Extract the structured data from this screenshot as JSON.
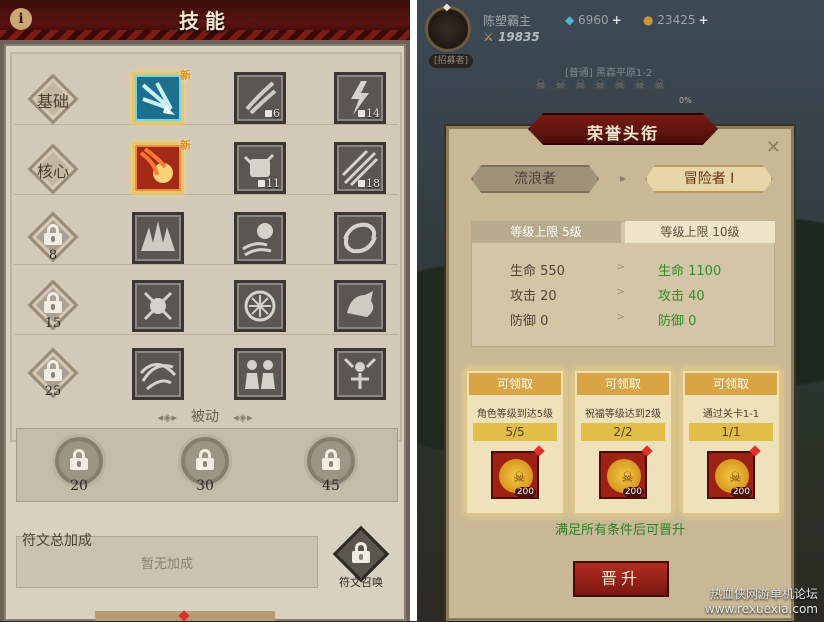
{
  "left": {
    "title": "技能",
    "info_icon": "i",
    "row_labels": [
      "基础",
      "核心"
    ],
    "lock_rows": [
      {
        "level": "8"
      },
      {
        "level": "15"
      },
      {
        "level": "25"
      }
    ],
    "new_tag": "新",
    "skill_levels": [
      "6",
      "14",
      "11",
      "18"
    ],
    "passive_label": "被动",
    "passive_slots": [
      "20",
      "30",
      "45"
    ],
    "rune_title": "符文总加成",
    "rune_empty": "暂无加成",
    "rune_summon": "符文召唤"
  },
  "right": {
    "player_name": "陈塑霸主",
    "power": "19835",
    "gems": "6960",
    "gold": "23425",
    "hire": "[招募者]",
    "stage": "[普通] 黑森平原1-2",
    "boss_pct": "0%",
    "modal": {
      "title": "荣誉头衔",
      "close": "✕",
      "rank_from": "流浪者",
      "rank_to": "冒险者 I",
      "limit_from": "等级上限 5级",
      "limit_to": "等级上限 10级",
      "stats": [
        {
          "old": "生命 550",
          "new": "生命 1100"
        },
        {
          "old": "攻击 20",
          "new": "攻击 40"
        },
        {
          "old": "防御 0",
          "new": "防御 0"
        }
      ],
      "rewards": [
        {
          "status": "可领取",
          "condition": "角色等级到达5级",
          "progress": "5/5",
          "qty": "200"
        },
        {
          "status": "可领取",
          "condition": "祝福等级达到2级",
          "progress": "2/2",
          "qty": "200"
        },
        {
          "status": "可领取",
          "condition": "通过关卡1-1",
          "progress": "1/1",
          "qty": "200"
        }
      ],
      "requirement": "满足所有条件后可晋升",
      "promote_label": "晋升"
    },
    "watermark_line1": "热血侠网游单机论坛",
    "watermark_line2": "www.rexuexia.com"
  }
}
